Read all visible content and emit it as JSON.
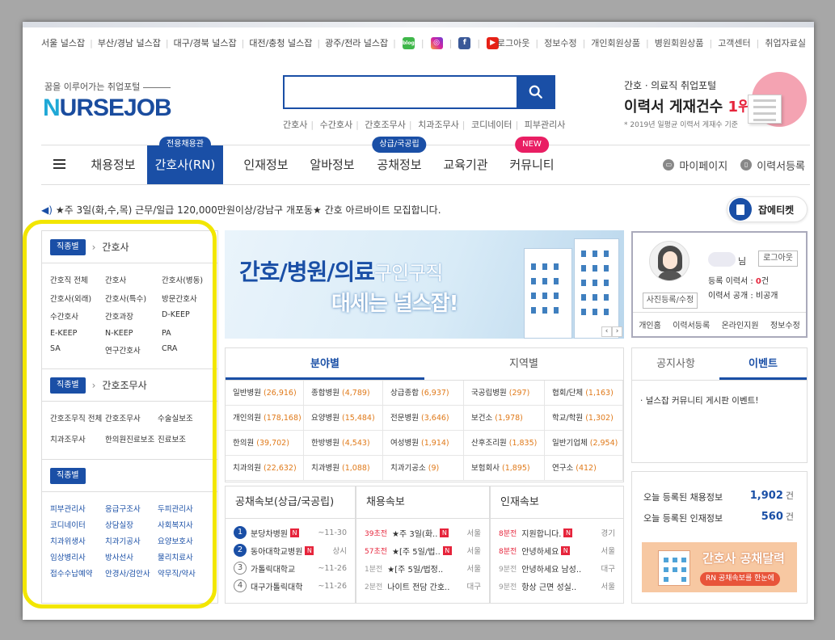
{
  "top_links": [
    "서울 널스잡",
    "부산/경남 널스잡",
    "대구/경북 널스잡",
    "대전/충청 널스잡",
    "광주/전라 널스잡"
  ],
  "sns": {
    "blog": "blog",
    "facebook": "f"
  },
  "user_links": [
    "로그아웃",
    "정보수정",
    "개인회원상품",
    "병원회원상품",
    "고객센터",
    "취업자료실"
  ],
  "logo": {
    "slogan": "꿈을 이루어가는 취업포털",
    "n": "N",
    "rest": "URSEJOB"
  },
  "search": {
    "placeholder": ""
  },
  "keywords": [
    "간호사",
    "수간호사",
    "간호조무사",
    "치과조무사",
    "코디네이터",
    "피부관리사"
  ],
  "promo": {
    "line1": "간호ㆍ의료직 취업포털",
    "line2": "이력서 게재건수",
    "line2_red": "1위!",
    "line3": "* 2019년 일평균 이력서 게재수 기준"
  },
  "nav": {
    "items": [
      {
        "label": "채용정보",
        "badge": ""
      },
      {
        "label": "간호사(RN)",
        "badge": "전용채용관"
      },
      {
        "label": "인재정보",
        "badge": ""
      },
      {
        "label": "알바정보",
        "badge": ""
      },
      {
        "label": "공채정보",
        "badge": "상급/국공립"
      },
      {
        "label": "교육기관",
        "badge": ""
      },
      {
        "label": "커뮤니티",
        "badge": "NEW"
      }
    ],
    "mypage": "마이페이지",
    "resume": "이력서등록"
  },
  "ticker": {
    "text": "★주 3일(화,수,목) 근무/일급 120,000만원이상/강남구 개포동★ 간호 아르바이트 모집합니다."
  },
  "job_edit": "잡에티켓",
  "sidebar": {
    "tag": "직종별",
    "section1_title": "간호사",
    "section1_items": [
      "간호직 전체",
      "간호사",
      "간호사(병동)",
      "간호사(외래)",
      "간호사(특수)",
      "방문간호사",
      "수간호사",
      "간호과장",
      "D-KEEP",
      "E-KEEP",
      "N-KEEP",
      "PA",
      "SA",
      "연구간호사",
      "CRA"
    ],
    "section2_title": "간호조무사",
    "section2_items": [
      "간호조무직 전체",
      "간호조무사",
      "수술실보조",
      "치과조무사",
      "한의원진료보조",
      "진료보조"
    ],
    "section3_items": [
      "피부관리사",
      "응급구조사",
      "두피관리사",
      "코디네이터",
      "상담실장",
      "사회복지사",
      "치과위생사",
      "치과기공사",
      "요양보호사",
      "임상병리사",
      "방사선사",
      "물리치료사",
      "접수수납예약",
      "안경사/검안사",
      "약무직/약사"
    ]
  },
  "banner": {
    "title_bold": "간호/병원/의료",
    "title_light": "구인구직",
    "line2": "대세는 널스잡!"
  },
  "profile": {
    "name_suffix": "님",
    "logout": "로그아웃",
    "photo_btn": "사진등록/수정",
    "registered_label": "등록 이력서 : ",
    "registered_value": "0",
    "registered_unit": "건",
    "public_text": "이력서 공개 : 비공개",
    "links": [
      "개인홈",
      "이력서등록",
      "온라인지원",
      "정보수정"
    ]
  },
  "category": {
    "tabs": [
      "분야별",
      "지역별"
    ],
    "cells": [
      {
        "name": "일반병원",
        "count": "(26,916)"
      },
      {
        "name": "종합병원",
        "count": "(4,789)"
      },
      {
        "name": "상급종합",
        "count": "(6,937)"
      },
      {
        "name": "국공립병원",
        "count": "(297)"
      },
      {
        "name": "협회/단체",
        "count": "(1,163)"
      },
      {
        "name": "개인의원",
        "count": "(178,168)"
      },
      {
        "name": "요양병원",
        "count": "(15,484)"
      },
      {
        "name": "전문병원",
        "count": "(3,646)"
      },
      {
        "name": "보건소",
        "count": "(1,978)"
      },
      {
        "name": "학교/학원",
        "count": "(1,302)"
      },
      {
        "name": "한의원",
        "count": "(39,702)"
      },
      {
        "name": "한방병원",
        "count": "(4,543)"
      },
      {
        "name": "여성병원",
        "count": "(1,914)"
      },
      {
        "name": "산후조리원",
        "count": "(1,835)"
      },
      {
        "name": "일반기업체",
        "count": "(2,954)"
      },
      {
        "name": "치과의원",
        "count": "(22,632)"
      },
      {
        "name": "치과병원",
        "count": "(1,088)"
      },
      {
        "name": "치과기공소",
        "count": "(9)"
      },
      {
        "name": "보험회사",
        "count": "(1,895)"
      },
      {
        "name": "연구소",
        "count": "(412)"
      }
    ]
  },
  "gongchae": {
    "title": "공채속보(상급/국공립)",
    "rows": [
      {
        "num": "1",
        "name": "분당차병원",
        "badge": "N",
        "date": "~11-30"
      },
      {
        "num": "2",
        "name": "동아대학교병원",
        "badge": "N",
        "date": "상시"
      },
      {
        "num": "3",
        "name": "가톨릭대학교",
        "badge": "",
        "date": "~11-26"
      },
      {
        "num": "4",
        "name": "대구가톨릭대학",
        "badge": "",
        "date": "~11-26"
      }
    ]
  },
  "chaeyong": {
    "title": "채용속보",
    "rows": [
      {
        "time": "39초전",
        "text": "★주 3일(화..",
        "badge": "N",
        "loc": "서울"
      },
      {
        "time": "57초전",
        "text": "★[주 5일/법..",
        "badge": "N",
        "loc": "서울"
      },
      {
        "time": "1분전",
        "text": "★[주 5일/법정..",
        "badge": "",
        "loc": "서울"
      },
      {
        "time": "2분전",
        "text": "나이트 전담 간호..",
        "badge": "",
        "loc": "대구"
      }
    ]
  },
  "injae": {
    "title": "인재속보",
    "rows": [
      {
        "time": "8분전",
        "text": "지원합니다.",
        "badge": "N",
        "loc": "경기"
      },
      {
        "time": "8분전",
        "text": "안녕하세요",
        "badge": "N",
        "loc": "서울"
      },
      {
        "time": "9분전",
        "text": "안녕하세요 남성..",
        "badge": "",
        "loc": "대구"
      },
      {
        "time": "9분전",
        "text": "항상 근면 성실..",
        "badge": "",
        "loc": "서울"
      }
    ]
  },
  "notice": {
    "tabs": [
      "공지사항",
      "이벤트"
    ],
    "item": "널스잡 커뮤니티 게시판 이벤트!"
  },
  "stats": {
    "jobs_label": "오늘 등록된 채용정보",
    "jobs_value": "1,902",
    "talent_label": "오늘 등록된 인재정보",
    "talent_value": "560",
    "unit": "건"
  },
  "calendar_banner": {
    "title": "간호사 공채달력",
    "sub": "RN 공채속보를 한눈에"
  },
  "colors": {
    "primary": "#1a4fa6",
    "accent_red": "#e6243b",
    "highlight": "#f2e600"
  }
}
